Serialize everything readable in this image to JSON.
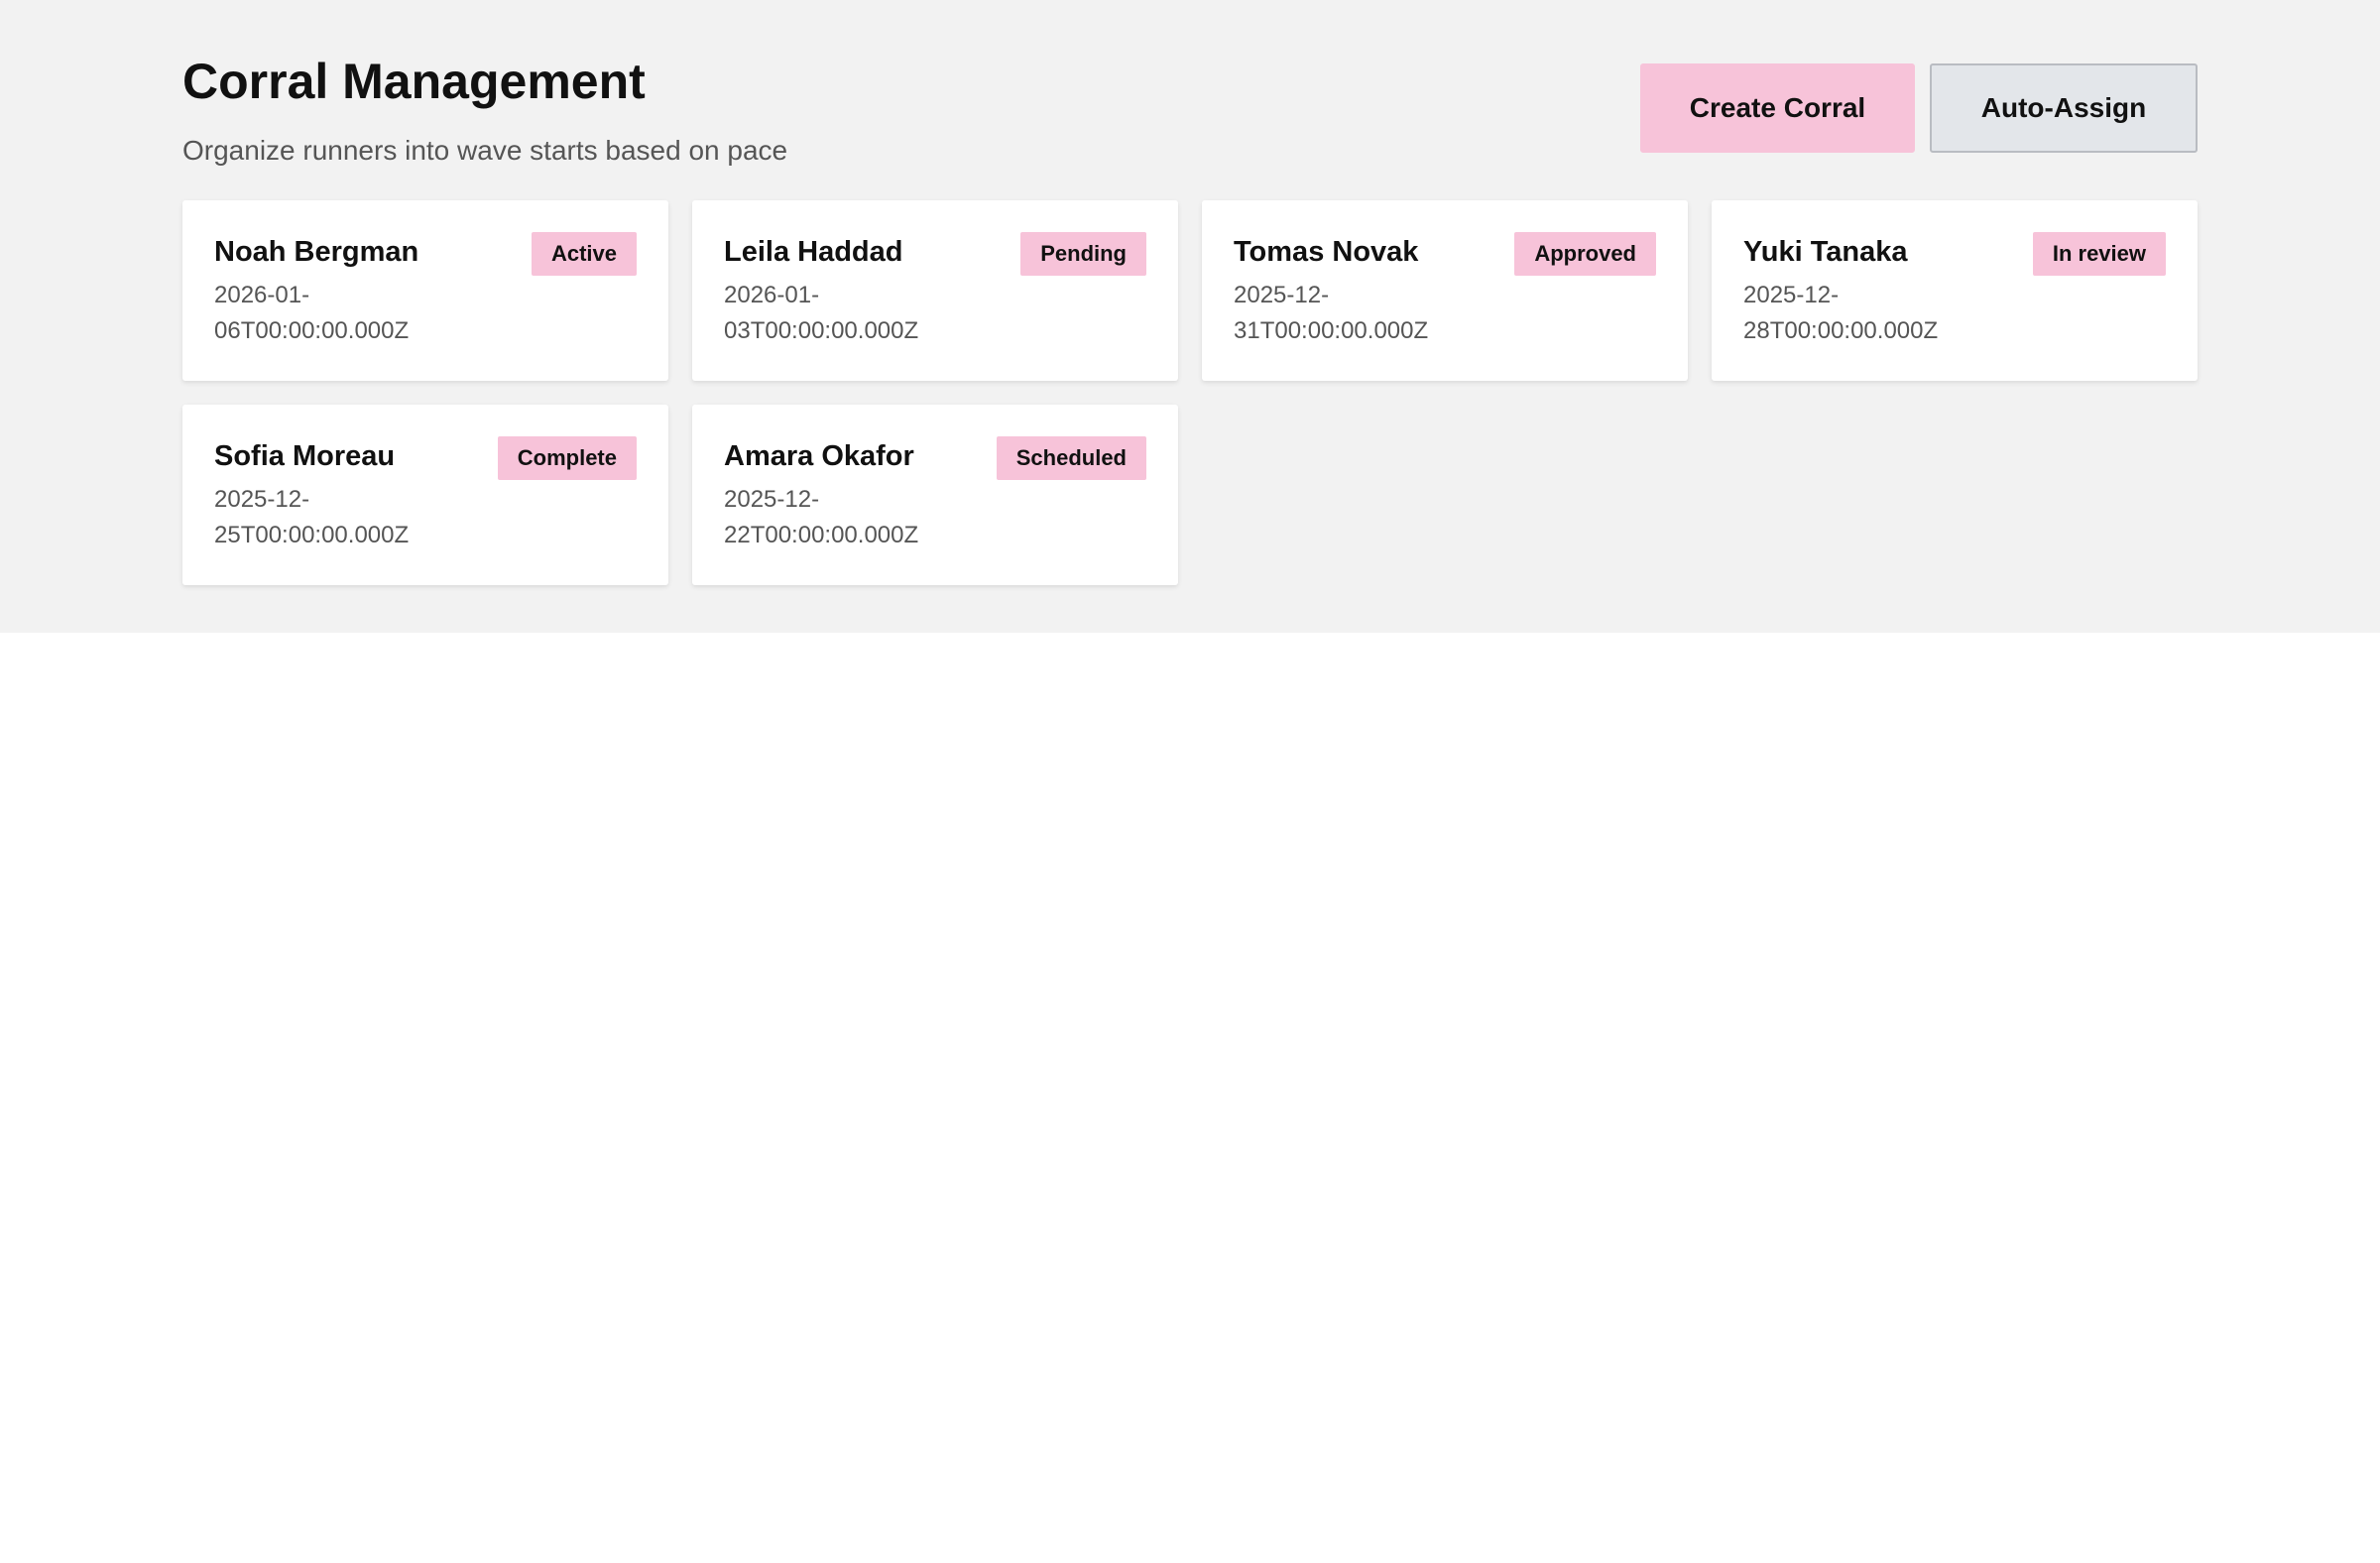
{
  "header": {
    "title": "Corral Management",
    "subtitle": "Organize runners into wave starts based on pace"
  },
  "actions": {
    "create_label": "Create Corral",
    "auto_assign_label": "Auto-Assign"
  },
  "colors": {
    "accent": "#f7c3d9",
    "panel_bg": "#f2f2f2",
    "secondary_button_bg": "#e3e6ea"
  },
  "cards": [
    {
      "name": "Noah Bergman",
      "status": "Active",
      "date_line1": "2026-01-",
      "date_line2": "06T00:00:00.000Z"
    },
    {
      "name": "Leila Haddad",
      "status": "Pending",
      "date_line1": "2026-01-",
      "date_line2": "03T00:00:00.000Z"
    },
    {
      "name": "Tomas Novak",
      "status": "Approved",
      "date_line1": "2025-12-",
      "date_line2": "31T00:00:00.000Z"
    },
    {
      "name": "Yuki Tanaka",
      "status": "In review",
      "date_line1": "2025-12-",
      "date_line2": "28T00:00:00.000Z"
    },
    {
      "name": "Sofia Moreau",
      "status": "Complete",
      "date_line1": "2025-12-",
      "date_line2": "25T00:00:00.000Z"
    },
    {
      "name": "Amara Okafor",
      "status": "Scheduled",
      "date_line1": "2025-12-",
      "date_line2": "22T00:00:00.000Z"
    }
  ]
}
